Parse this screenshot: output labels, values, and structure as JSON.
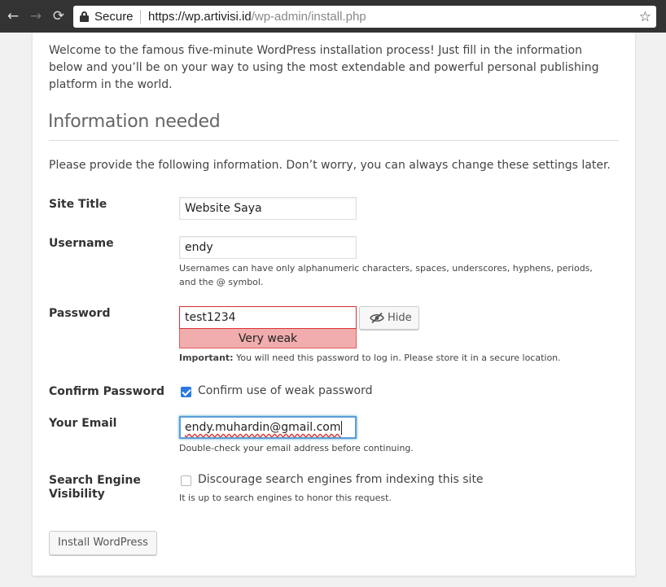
{
  "browser": {
    "back": "←",
    "forward": "→",
    "reload": "⟳",
    "secure_label": "Secure",
    "url_host": "https://wp.artivisi.id",
    "url_path": "/wp-admin/install.php",
    "star": "☆"
  },
  "intro": {
    "welcome": "Welcome to the famous five-minute WordPress installation process! Just fill in the information below and you’ll be on your way to using the most extendable and powerful personal publishing platform in the world.",
    "heading": "Information needed",
    "provide": "Please provide the following information. Don’t worry, you can always change these settings later."
  },
  "form": {
    "site_title": {
      "label": "Site Title",
      "value": "Website Saya"
    },
    "username": {
      "label": "Username",
      "value": "endy",
      "desc": "Usernames can have only alphanumeric characters, spaces, underscores, hyphens, periods, and the @ symbol."
    },
    "password": {
      "label": "Password",
      "value": "test1234",
      "strength": "Very weak",
      "hide_label": "Hide",
      "important_label": "Important:",
      "important_text": " You will need this password to log in. Please store it in a secure location."
    },
    "confirm_password": {
      "label": "Confirm Password",
      "checkbox_label": "Confirm use of weak password",
      "checked": true
    },
    "email": {
      "label": "Your Email",
      "value": "endy.muhardin@gmail.com",
      "desc": "Double-check your email address before continuing."
    },
    "search_visibility": {
      "label_line1": "Search Engine",
      "label_line2": "Visibility",
      "checkbox_label": "Discourage search engines from indexing this site",
      "checked": false,
      "desc": "It is up to search engines to honor this request."
    },
    "install_button": "Install WordPress"
  },
  "colors": {
    "weak_bg": "#f1adad",
    "weak_border": "#dc3232",
    "focus_border": "#5b9dd9",
    "checkbox_checked": "#2a7ae2"
  }
}
